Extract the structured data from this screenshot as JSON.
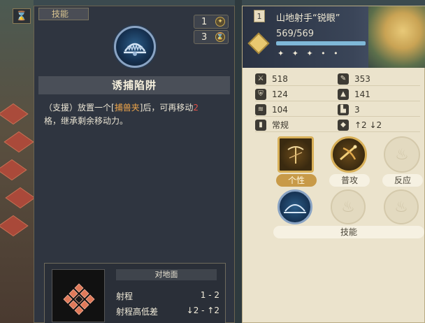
{
  "skill_panel": {
    "tab_label": "技能",
    "counter_top": "1",
    "counter_top_icon": "plus-icon",
    "counter_bottom": "3",
    "counter_bottom_icon": "hourglass-icon",
    "skill_name": "诱捕陷阱",
    "desc_prefix": "（支援）放置一个[",
    "desc_item": "捕兽夹",
    "desc_mid": "]后，可再移动",
    "desc_number": "2",
    "desc_suffix": "格，继承剩余移动力。",
    "range_header": "对地面",
    "range_label": "射程",
    "range_value": "1 - 2",
    "height_label": "射程高低差",
    "height_value": "↓2 - ↑2"
  },
  "unit_panel": {
    "level": "1",
    "name": "山地射手“锐眼”",
    "hp": "569/569",
    "stars": "✦ ✦ ✦ • •",
    "stats": [
      {
        "icon": "sword-icon",
        "value": "518"
      },
      {
        "icon": "magic-icon",
        "value": "353"
      },
      {
        "icon": "shield-icon",
        "value": "124"
      },
      {
        "icon": "hat-icon",
        "value": "141"
      },
      {
        "icon": "speed-icon",
        "value": "104"
      },
      {
        "icon": "boot-icon",
        "value": "3"
      },
      {
        "icon": "terrain-icon",
        "value": "常规"
      },
      {
        "icon": "height-icon",
        "value": "↑2 ↓2"
      }
    ],
    "abilities": {
      "trait_label": "个性",
      "attack_label": "普攻",
      "reaction_label": "反应",
      "skills_label": "技能"
    }
  }
}
